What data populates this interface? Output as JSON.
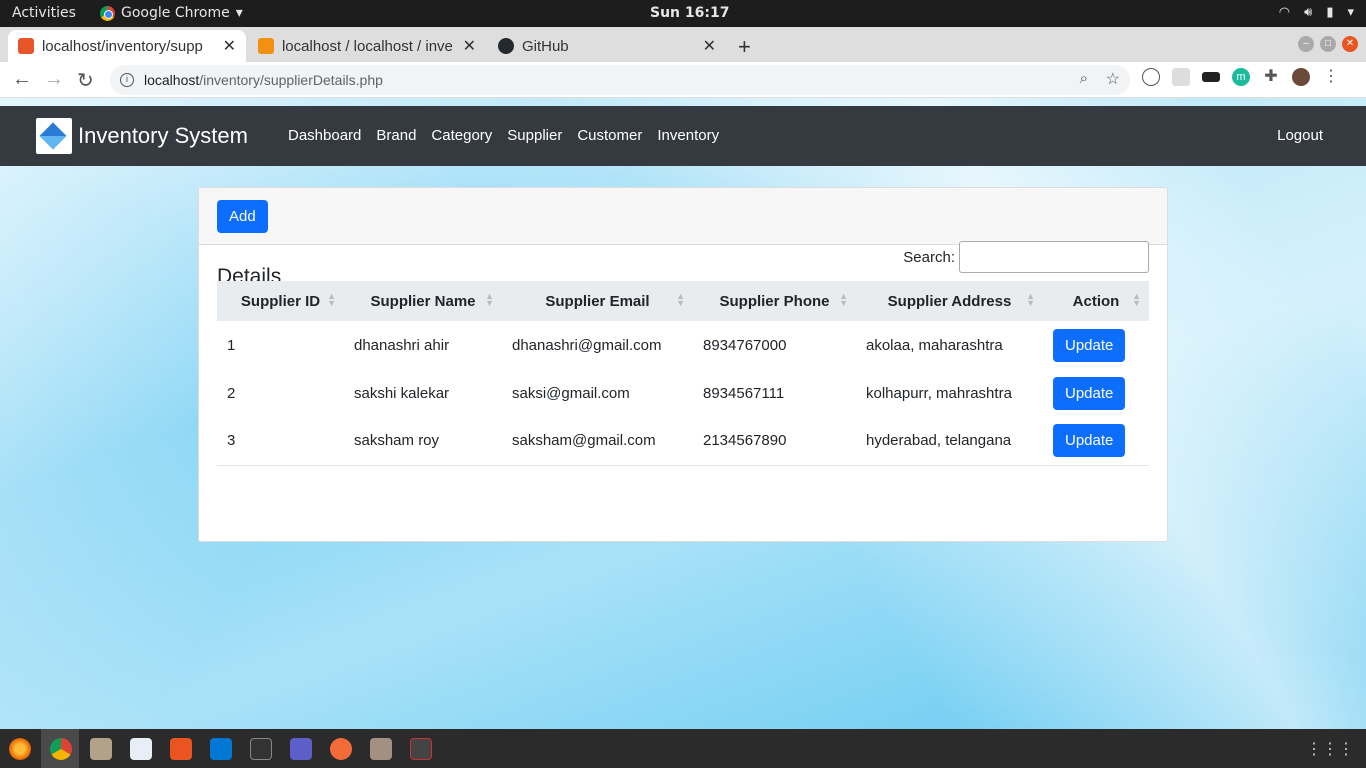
{
  "system": {
    "activities": "Activities",
    "app_menu": "Google Chrome",
    "clock": "Sun 16:17"
  },
  "browser": {
    "tabs": [
      {
        "title": "localhost/inventory/supp",
        "favicon_color": "#e8552b"
      },
      {
        "title": "localhost / localhost / inve",
        "favicon_color": "#f29111"
      },
      {
        "title": "GitHub",
        "favicon_color": "#24292e"
      }
    ],
    "url_host": "localhost",
    "url_path": "/inventory/supplierDetails.php"
  },
  "app": {
    "brand": "Inventory System",
    "nav": [
      "Dashboard",
      "Brand",
      "Category",
      "Supplier",
      "Customer",
      "Inventory"
    ],
    "logout": "Logout",
    "add_button": "Add",
    "card_title": "Details",
    "search_label": "Search:",
    "columns": [
      "Supplier ID",
      "Supplier Name",
      "Supplier Email",
      "Supplier Phone",
      "Supplier Address",
      "Action"
    ],
    "rows": [
      {
        "id": "1",
        "name": "dhanashri ahir",
        "email": "dhanashri@gmail.com",
        "phone": "8934767000",
        "address": "akolaa, maharashtra",
        "action": "Update"
      },
      {
        "id": "2",
        "name": "sakshi kalekar",
        "email": "saksi@gmail.com",
        "phone": "8934567111",
        "address": "kolhapurr, mahrashtra",
        "action": "Update"
      },
      {
        "id": "3",
        "name": "saksham roy",
        "email": "saksham@gmail.com",
        "phone": "2134567890",
        "address": "hyderabad, telangana",
        "action": "Update"
      }
    ],
    "accent": "#0d6efd",
    "navbar_color": "#343a40"
  }
}
